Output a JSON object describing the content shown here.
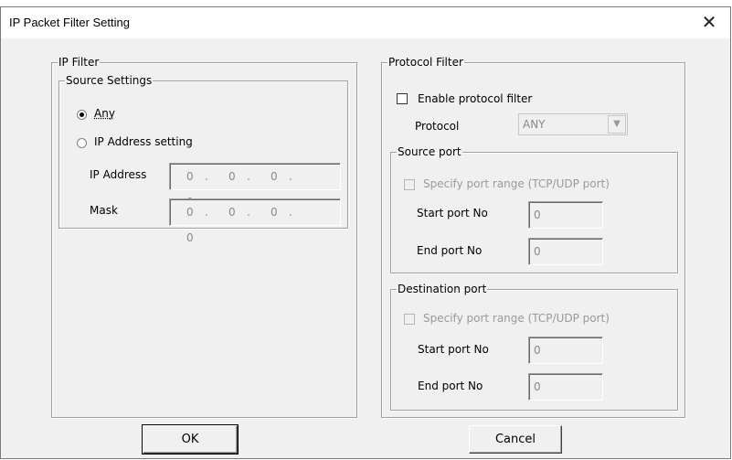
{
  "window": {
    "title": "IP Packet Filter Setting",
    "close_glyph": "✕"
  },
  "ip_filter": {
    "legend": "IP Filter",
    "source_settings": {
      "legend": "Source Settings",
      "option_any": "Any",
      "option_ip": "IP Address setting",
      "selected": "Any",
      "ip_address_label": "IP Address",
      "ip_address": [
        "0",
        "0",
        "0",
        "0"
      ],
      "mask_label": "Mask",
      "mask": [
        "0",
        "0",
        "0",
        "0"
      ],
      "dot": "."
    }
  },
  "protocol_filter": {
    "legend": "Protocol Filter",
    "enable_label": "Enable protocol filter",
    "enabled": false,
    "protocol_label": "Protocol",
    "protocol_value": "ANY",
    "source_port": {
      "legend": "Source port",
      "specify_label": "Specify port range (TCP/UDP port)",
      "start_label": "Start port No",
      "start_value": "0",
      "end_label": "End port No",
      "end_value": "0"
    },
    "destination_port": {
      "legend": "Destination port",
      "specify_label": "Specify port range (TCP/UDP port)",
      "start_label": "Start port No",
      "start_value": "0",
      "end_label": "End port No",
      "end_value": "0"
    }
  },
  "buttons": {
    "ok": "OK",
    "cancel": "Cancel"
  }
}
